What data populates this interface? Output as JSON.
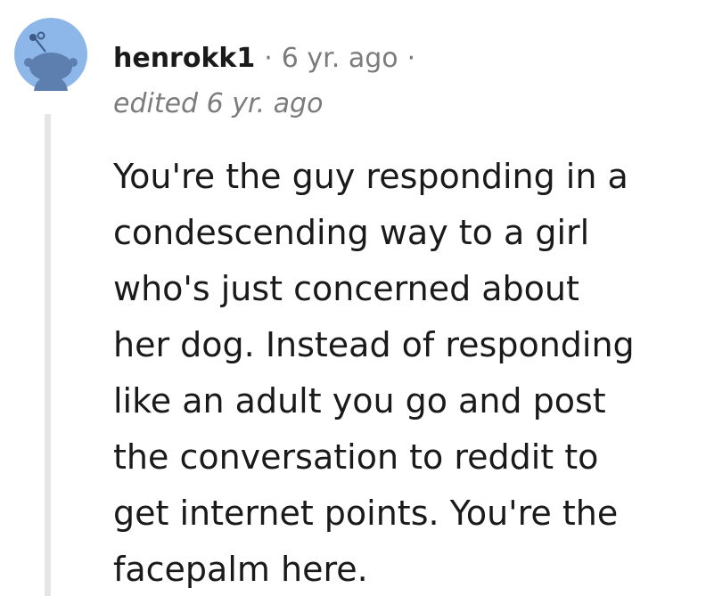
{
  "comment": {
    "author": "henrokk1",
    "separator": "·",
    "timestamp": "6 yr. ago",
    "edited": "edited 6 yr. ago",
    "avatar": "snoo-avatar-icon",
    "colors": {
      "avatar_bg": "#8db7e8",
      "snoo": "#5d7fb0",
      "thread_line": "#e6e6e6",
      "meta_text": "#7c7c7c"
    },
    "body_lines": [
      "You're the guy responding in a",
      "condescending way to a girl",
      "who's just concerned about",
      "her dog. Instead of responding",
      "like an adult you go and post",
      "the conversation to reddit to",
      "get internet points. You're the",
      "facepalm here."
    ]
  }
}
